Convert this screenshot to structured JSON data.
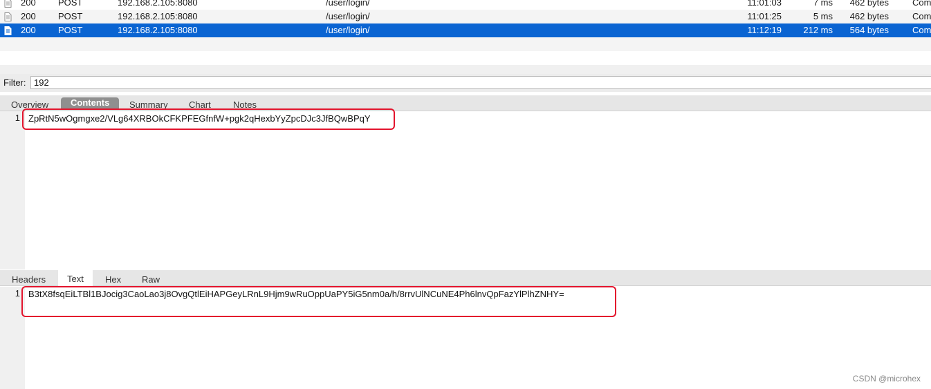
{
  "requests": [
    {
      "status": "200",
      "method": "POST",
      "host": "192.168.2.105:8080",
      "path": "/user/login/",
      "time": "11:01:03",
      "duration": "7 ms",
      "size": "462 bytes",
      "state": "Com",
      "icon": "document-icon",
      "selected": false
    },
    {
      "status": "200",
      "method": "POST",
      "host": "192.168.2.105:8080",
      "path": "/user/login/",
      "time": "11:01:25",
      "duration": "5 ms",
      "size": "462 bytes",
      "state": "Com",
      "icon": "document-icon",
      "selected": false
    },
    {
      "status": "200",
      "method": "POST",
      "host": "192.168.2.105:8080",
      "path": "/user/login/",
      "time": "11:12:19",
      "duration": "212 ms",
      "size": "564 bytes",
      "state": "Com",
      "icon": "document-icon",
      "selected": true
    }
  ],
  "filter": {
    "label": "Filter:",
    "value": "192"
  },
  "request_tabs": [
    {
      "label": "Overview",
      "active": false
    },
    {
      "label": "Contents",
      "active": true
    },
    {
      "label": "Summary",
      "active": false
    },
    {
      "label": "Chart",
      "active": false
    },
    {
      "label": "Notes",
      "active": false
    }
  ],
  "request_body": {
    "line_number": "1",
    "text": "ZpRtN5wOgmgxe2/VLg64XRBOkCFKPFEGfnfW+pgk2qHexbYyZpcDJc3JfBQwBPqY"
  },
  "response_tabs": [
    {
      "label": "Headers",
      "active": false
    },
    {
      "label": "Text",
      "active": true
    },
    {
      "label": "Hex",
      "active": false
    },
    {
      "label": "Raw",
      "active": false
    }
  ],
  "response_body": {
    "line_number": "1",
    "text": "B3tX8fsqEiLTBl1BJocig3CaoLao3j8OvgQtlEiHAPGeyLRnL9Hjm9wRuOppUaPY5iG5nm0a/h/8rrvUlNCuNE4Ph6lnvQpFazYlPlhZNHY="
  },
  "colors": {
    "selection": "#0a64d2",
    "highlight_box": "#e3142d",
    "active_tab": "#8f8f8f"
  },
  "watermark": "CSDN @microhex"
}
